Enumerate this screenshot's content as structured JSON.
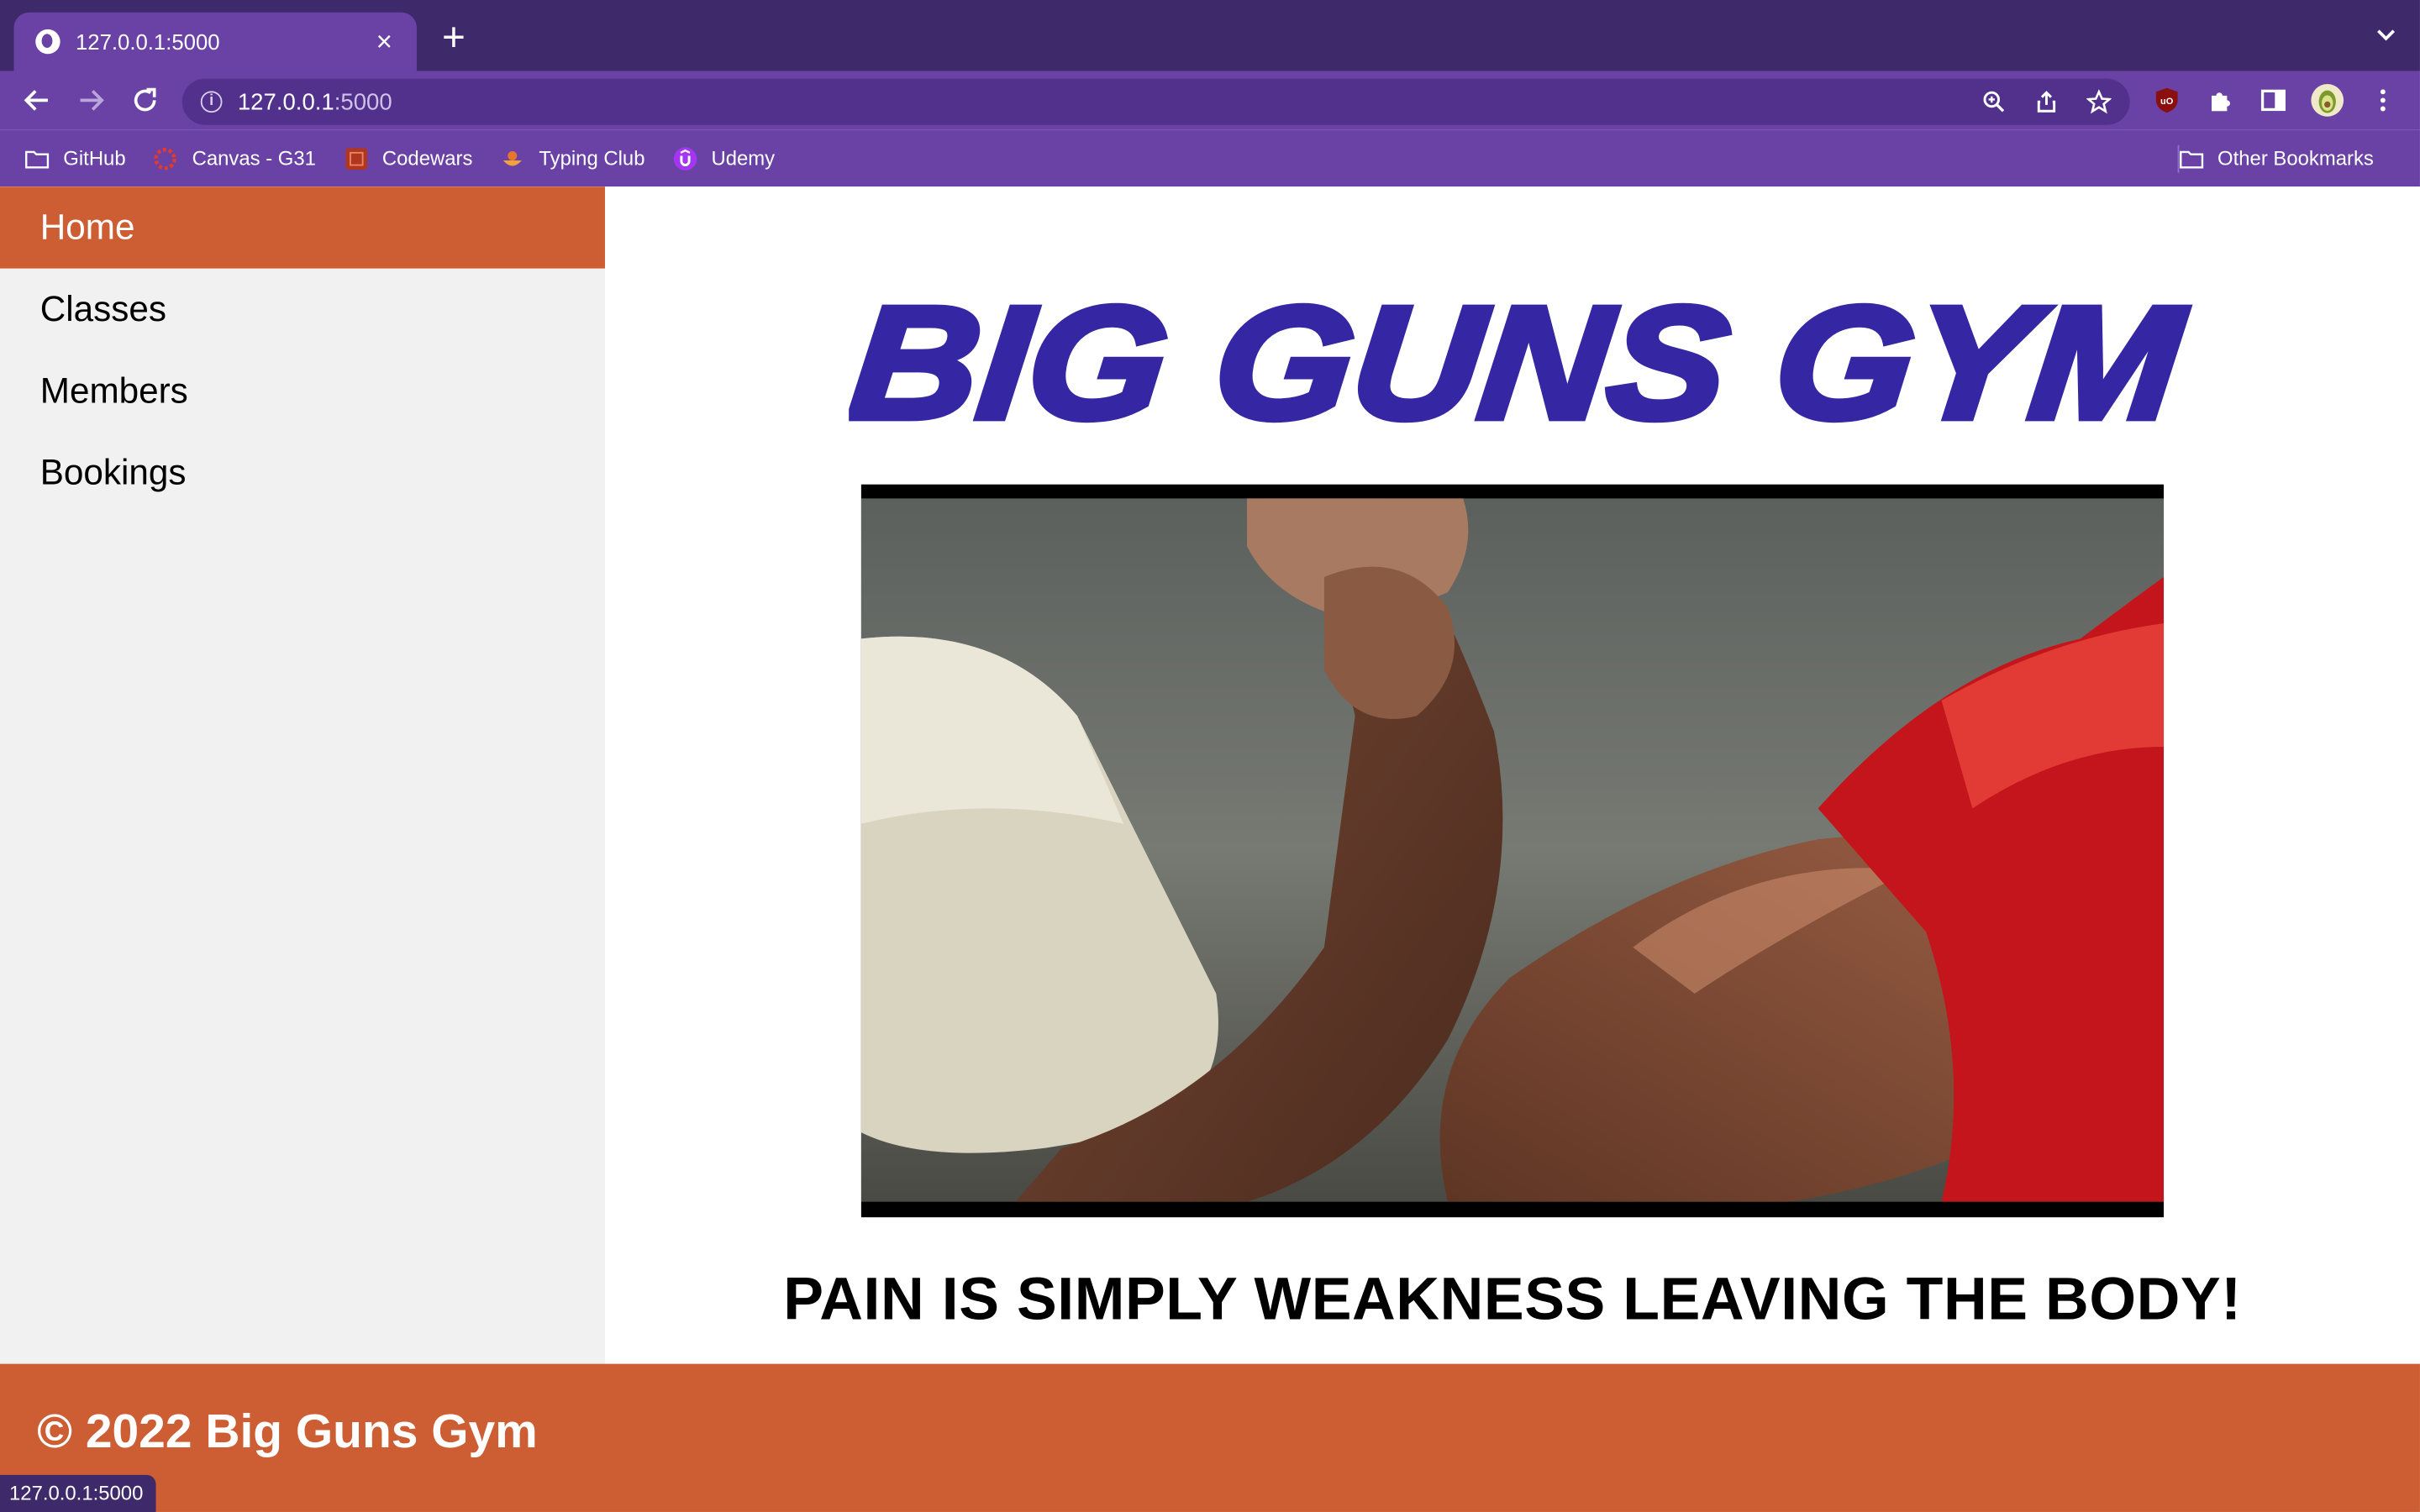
{
  "browser": {
    "tab": {
      "title": "127.0.0.1:5000"
    },
    "address": {
      "host": "127.0.0.1",
      "port": ":5000"
    },
    "bookmarks": [
      {
        "label": "GitHub",
        "icon": "folder-icon"
      },
      {
        "label": "Canvas - G31",
        "icon": "canvas-icon"
      },
      {
        "label": "Codewars",
        "icon": "codewars-icon"
      },
      {
        "label": "Typing Club",
        "icon": "typingclub-icon"
      },
      {
        "label": "Udemy",
        "icon": "udemy-icon"
      }
    ],
    "other_bookmarks": "Other Bookmarks",
    "status_url": "127.0.0.1:5000"
  },
  "nav": {
    "items": [
      {
        "label": "Home",
        "active": true
      },
      {
        "label": "Classes"
      },
      {
        "label": "Members"
      },
      {
        "label": "Bookings"
      }
    ]
  },
  "main": {
    "logo_text": "BIG GUNS GYM",
    "motto": "PAIN IS SIMPLY WEAKNESS LEAVING THE BODY!"
  },
  "footer": {
    "text": "© 2022 Big Guns Gym"
  },
  "colors": {
    "accent": "#cd5d33",
    "logo": "#3527a3",
    "chrome": "#6a42a5",
    "chrome_dark": "#3e2a6b"
  }
}
